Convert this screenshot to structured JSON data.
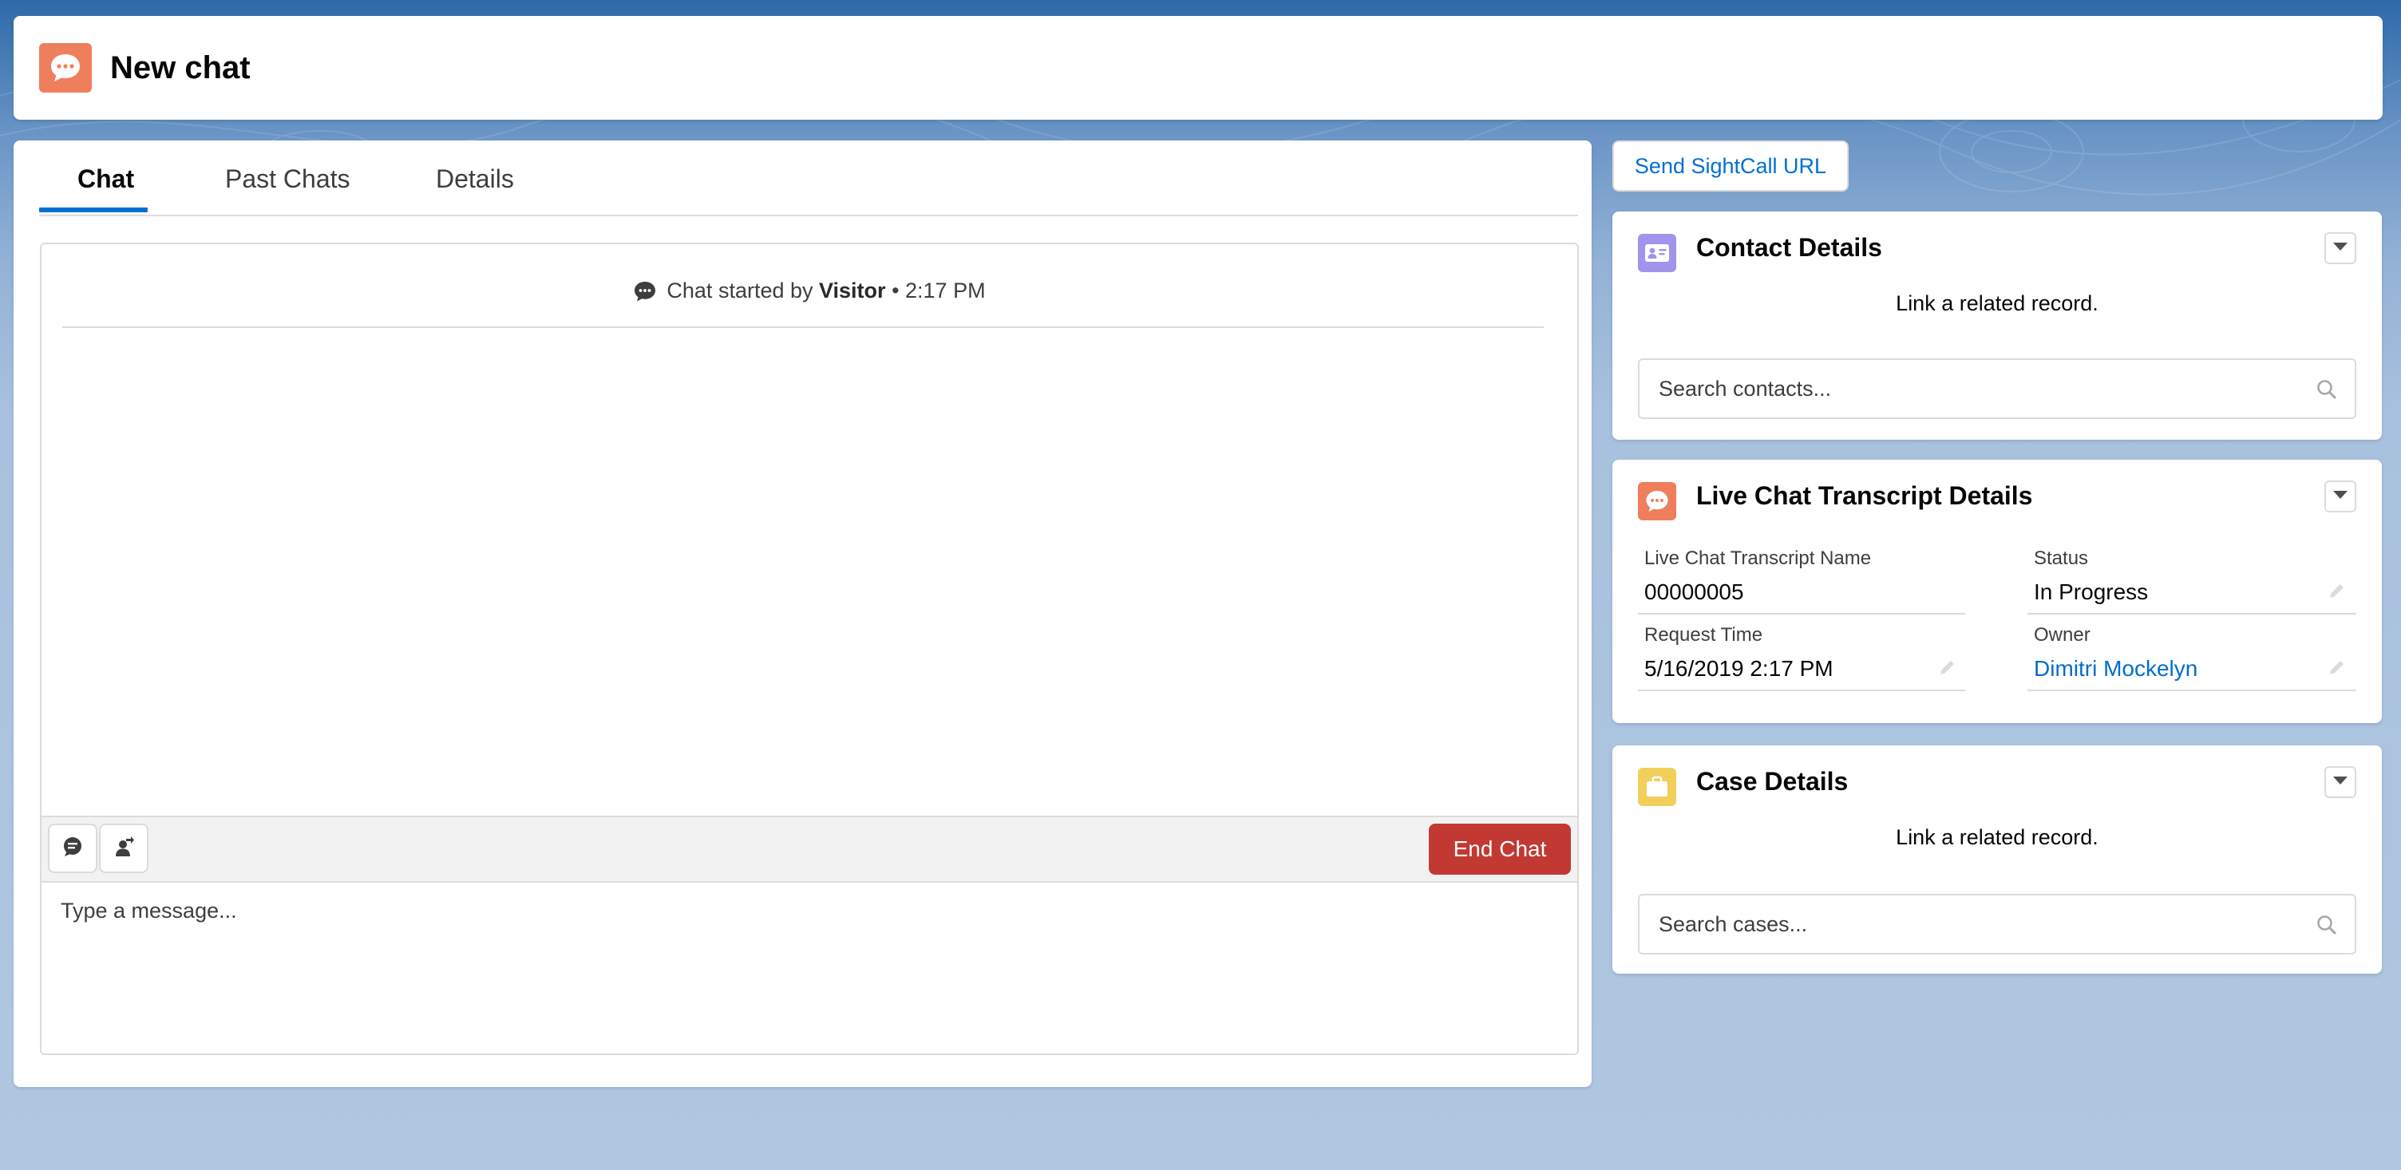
{
  "header": {
    "title": "New chat",
    "icon": "chat-icon",
    "icon_color": "#ef7e5d"
  },
  "chat": {
    "tabs": [
      {
        "label": "Chat",
        "active": true
      },
      {
        "label": "Past Chats",
        "active": false
      },
      {
        "label": "Details",
        "active": false
      }
    ],
    "start_prefix": "Chat started by",
    "start_by": "Visitor",
    "start_time": "• 2:17 PM",
    "end_chat_label": "End Chat",
    "message_placeholder": "Type a message...",
    "accent_color": "#0070d2",
    "end_color": "#c23934"
  },
  "sidebar": {
    "sightcall_label": "Send SightCall URL",
    "contact_card": {
      "title": "Contact Details",
      "note": "Link a related record.",
      "search_placeholder": "Search contacts...",
      "icon_color": "#a094ed"
    },
    "transcript_card": {
      "title": "Live Chat Transcript Details",
      "icon_color": "#ef7e5d",
      "fields": {
        "name_label": "Live Chat Transcript Name",
        "name_value": "00000005",
        "status_label": "Status",
        "status_value": "In Progress",
        "request_label": "Request Time",
        "request_value": "5/16/2019 2:17 PM",
        "owner_label": "Owner",
        "owner_value": "Dimitri Mockelyn"
      }
    },
    "case_card": {
      "title": "Case Details",
      "note": "Link a related record.",
      "search_placeholder": "Search cases...",
      "icon_color": "#f2cf5b"
    }
  }
}
